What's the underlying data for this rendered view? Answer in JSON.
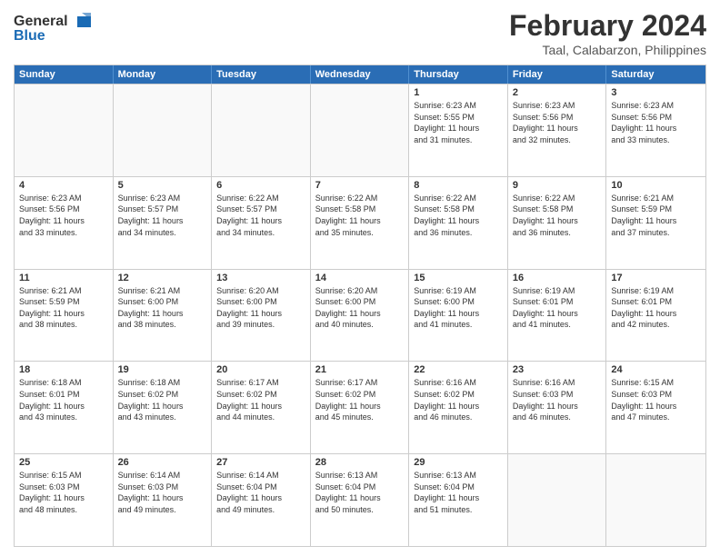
{
  "header": {
    "logo_general": "General",
    "logo_blue": "Blue",
    "month_title": "February 2024",
    "location": "Taal, Calabarzon, Philippines"
  },
  "weekdays": [
    "Sunday",
    "Monday",
    "Tuesday",
    "Wednesday",
    "Thursday",
    "Friday",
    "Saturday"
  ],
  "weeks": [
    [
      {
        "day": "",
        "info": ""
      },
      {
        "day": "",
        "info": ""
      },
      {
        "day": "",
        "info": ""
      },
      {
        "day": "",
        "info": ""
      },
      {
        "day": "1",
        "info": "Sunrise: 6:23 AM\nSunset: 5:55 PM\nDaylight: 11 hours\nand 31 minutes."
      },
      {
        "day": "2",
        "info": "Sunrise: 6:23 AM\nSunset: 5:56 PM\nDaylight: 11 hours\nand 32 minutes."
      },
      {
        "day": "3",
        "info": "Sunrise: 6:23 AM\nSunset: 5:56 PM\nDaylight: 11 hours\nand 33 minutes."
      }
    ],
    [
      {
        "day": "4",
        "info": "Sunrise: 6:23 AM\nSunset: 5:56 PM\nDaylight: 11 hours\nand 33 minutes."
      },
      {
        "day": "5",
        "info": "Sunrise: 6:23 AM\nSunset: 5:57 PM\nDaylight: 11 hours\nand 34 minutes."
      },
      {
        "day": "6",
        "info": "Sunrise: 6:22 AM\nSunset: 5:57 PM\nDaylight: 11 hours\nand 34 minutes."
      },
      {
        "day": "7",
        "info": "Sunrise: 6:22 AM\nSunset: 5:58 PM\nDaylight: 11 hours\nand 35 minutes."
      },
      {
        "day": "8",
        "info": "Sunrise: 6:22 AM\nSunset: 5:58 PM\nDaylight: 11 hours\nand 36 minutes."
      },
      {
        "day": "9",
        "info": "Sunrise: 6:22 AM\nSunset: 5:58 PM\nDaylight: 11 hours\nand 36 minutes."
      },
      {
        "day": "10",
        "info": "Sunrise: 6:21 AM\nSunset: 5:59 PM\nDaylight: 11 hours\nand 37 minutes."
      }
    ],
    [
      {
        "day": "11",
        "info": "Sunrise: 6:21 AM\nSunset: 5:59 PM\nDaylight: 11 hours\nand 38 minutes."
      },
      {
        "day": "12",
        "info": "Sunrise: 6:21 AM\nSunset: 6:00 PM\nDaylight: 11 hours\nand 38 minutes."
      },
      {
        "day": "13",
        "info": "Sunrise: 6:20 AM\nSunset: 6:00 PM\nDaylight: 11 hours\nand 39 minutes."
      },
      {
        "day": "14",
        "info": "Sunrise: 6:20 AM\nSunset: 6:00 PM\nDaylight: 11 hours\nand 40 minutes."
      },
      {
        "day": "15",
        "info": "Sunrise: 6:19 AM\nSunset: 6:00 PM\nDaylight: 11 hours\nand 41 minutes."
      },
      {
        "day": "16",
        "info": "Sunrise: 6:19 AM\nSunset: 6:01 PM\nDaylight: 11 hours\nand 41 minutes."
      },
      {
        "day": "17",
        "info": "Sunrise: 6:19 AM\nSunset: 6:01 PM\nDaylight: 11 hours\nand 42 minutes."
      }
    ],
    [
      {
        "day": "18",
        "info": "Sunrise: 6:18 AM\nSunset: 6:01 PM\nDaylight: 11 hours\nand 43 minutes."
      },
      {
        "day": "19",
        "info": "Sunrise: 6:18 AM\nSunset: 6:02 PM\nDaylight: 11 hours\nand 43 minutes."
      },
      {
        "day": "20",
        "info": "Sunrise: 6:17 AM\nSunset: 6:02 PM\nDaylight: 11 hours\nand 44 minutes."
      },
      {
        "day": "21",
        "info": "Sunrise: 6:17 AM\nSunset: 6:02 PM\nDaylight: 11 hours\nand 45 minutes."
      },
      {
        "day": "22",
        "info": "Sunrise: 6:16 AM\nSunset: 6:02 PM\nDaylight: 11 hours\nand 46 minutes."
      },
      {
        "day": "23",
        "info": "Sunrise: 6:16 AM\nSunset: 6:03 PM\nDaylight: 11 hours\nand 46 minutes."
      },
      {
        "day": "24",
        "info": "Sunrise: 6:15 AM\nSunset: 6:03 PM\nDaylight: 11 hours\nand 47 minutes."
      }
    ],
    [
      {
        "day": "25",
        "info": "Sunrise: 6:15 AM\nSunset: 6:03 PM\nDaylight: 11 hours\nand 48 minutes."
      },
      {
        "day": "26",
        "info": "Sunrise: 6:14 AM\nSunset: 6:03 PM\nDaylight: 11 hours\nand 49 minutes."
      },
      {
        "day": "27",
        "info": "Sunrise: 6:14 AM\nSunset: 6:04 PM\nDaylight: 11 hours\nand 49 minutes."
      },
      {
        "day": "28",
        "info": "Sunrise: 6:13 AM\nSunset: 6:04 PM\nDaylight: 11 hours\nand 50 minutes."
      },
      {
        "day": "29",
        "info": "Sunrise: 6:13 AM\nSunset: 6:04 PM\nDaylight: 11 hours\nand 51 minutes."
      },
      {
        "day": "",
        "info": ""
      },
      {
        "day": "",
        "info": ""
      }
    ]
  ]
}
